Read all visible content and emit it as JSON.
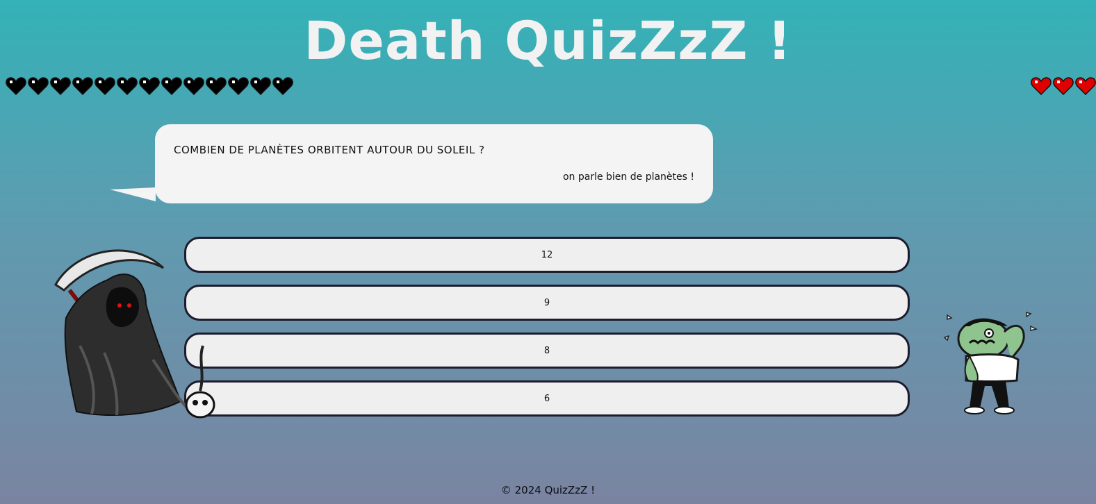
{
  "header": {
    "title": "Death QuizZzZ !"
  },
  "lives": {
    "lost_count": 13,
    "remaining_count": 3,
    "lost_icon": "black-heart-icon",
    "remaining_icon": "red-heart-icon",
    "lost_color": "#000000",
    "remaining_color": "#e00000"
  },
  "question": {
    "text": "COMBIEN DE PLANÈTES ORBITENT AUTOUR DU SOLEIL ?",
    "hint": "on parle bien de planètes !"
  },
  "answers": [
    {
      "label": "12"
    },
    {
      "label": "9"
    },
    {
      "label": "8"
    },
    {
      "label": "6"
    }
  ],
  "characters": {
    "left": "grim-reaper-with-scythe",
    "right": "worried-zombie"
  },
  "footer": {
    "text": "© 2024 QuizZzZ !"
  },
  "colors": {
    "bg_top": "#33b2b7",
    "bg_bottom": "#7a84a1",
    "bubble": "#f4f4f4",
    "answer_bg": "#efefef",
    "answer_border": "#1c1c2e"
  }
}
